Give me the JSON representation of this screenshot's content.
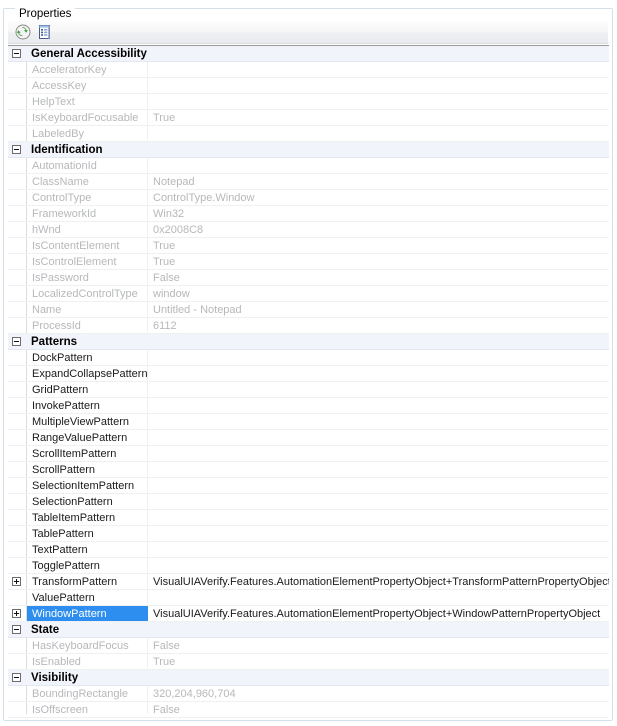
{
  "groupbox": {
    "title": "Properties"
  },
  "toolbar": {
    "buttons": [
      {
        "name": "refresh-icon",
        "tooltip": "Refresh"
      },
      {
        "name": "properties-list-icon",
        "tooltip": "Properties"
      }
    ]
  },
  "colors": {
    "selection": "#2e8ef0",
    "category_bg": "#f1f4fa",
    "dim_text": "#b6b8bb",
    "dark_text": "#1a1a1a"
  },
  "grid": {
    "rows": [
      {
        "type": "category",
        "name": "General Accessibility",
        "expander": "minus"
      },
      {
        "type": "property",
        "name": "AcceleratorKey",
        "value": "",
        "tone": "dim"
      },
      {
        "type": "property",
        "name": "AccessKey",
        "value": "",
        "tone": "dim"
      },
      {
        "type": "property",
        "name": "HelpText",
        "value": "",
        "tone": "dim"
      },
      {
        "type": "property",
        "name": "IsKeyboardFocusable",
        "value": "True",
        "tone": "dim"
      },
      {
        "type": "property",
        "name": "LabeledBy",
        "value": "",
        "tone": "dim"
      },
      {
        "type": "category",
        "name": "Identification",
        "expander": "minus"
      },
      {
        "type": "property",
        "name": "AutomationId",
        "value": "",
        "tone": "dim"
      },
      {
        "type": "property",
        "name": "ClassName",
        "value": "Notepad",
        "tone": "dim"
      },
      {
        "type": "property",
        "name": "ControlType",
        "value": "ControlType.Window",
        "tone": "dim"
      },
      {
        "type": "property",
        "name": "FrameworkId",
        "value": "Win32",
        "tone": "dim"
      },
      {
        "type": "property",
        "name": "hWnd",
        "value": "0x2008C8",
        "tone": "dim"
      },
      {
        "type": "property",
        "name": "IsContentElement",
        "value": "True",
        "tone": "dim"
      },
      {
        "type": "property",
        "name": "IsControlElement",
        "value": "True",
        "tone": "dim"
      },
      {
        "type": "property",
        "name": "IsPassword",
        "value": "False",
        "tone": "dim"
      },
      {
        "type": "property",
        "name": "LocalizedControlType",
        "value": "window",
        "tone": "dim"
      },
      {
        "type": "property",
        "name": "Name",
        "value": "Untitled - Notepad",
        "tone": "dim"
      },
      {
        "type": "property",
        "name": "ProcessId",
        "value": "6112",
        "tone": "dim"
      },
      {
        "type": "category",
        "name": "Patterns",
        "expander": "minus"
      },
      {
        "type": "property",
        "name": "DockPattern",
        "value": "",
        "tone": "dark"
      },
      {
        "type": "property",
        "name": "ExpandCollapsePattern",
        "value": "",
        "tone": "dark"
      },
      {
        "type": "property",
        "name": "GridPattern",
        "value": "",
        "tone": "dark"
      },
      {
        "type": "property",
        "name": "InvokePattern",
        "value": "",
        "tone": "dark"
      },
      {
        "type": "property",
        "name": "MultipleViewPattern",
        "value": "",
        "tone": "dark"
      },
      {
        "type": "property",
        "name": "RangeValuePattern",
        "value": "",
        "tone": "dark"
      },
      {
        "type": "property",
        "name": "ScrollItemPattern",
        "value": "",
        "tone": "dark"
      },
      {
        "type": "property",
        "name": "ScrollPattern",
        "value": "",
        "tone": "dark"
      },
      {
        "type": "property",
        "name": "SelectionItemPattern",
        "value": "",
        "tone": "dark"
      },
      {
        "type": "property",
        "name": "SelectionPattern",
        "value": "",
        "tone": "dark"
      },
      {
        "type": "property",
        "name": "TableItemPattern",
        "value": "",
        "tone": "dark"
      },
      {
        "type": "property",
        "name": "TablePattern",
        "value": "",
        "tone": "dark"
      },
      {
        "type": "property",
        "name": "TextPattern",
        "value": "",
        "tone": "dark"
      },
      {
        "type": "property",
        "name": "TogglePattern",
        "value": "",
        "tone": "dark"
      },
      {
        "type": "property",
        "name": "TransformPattern",
        "value": "VisualUIAVerify.Features.AutomationElementPropertyObject+TransformPatternPropertyObject",
        "tone": "dark",
        "expander": "plus"
      },
      {
        "type": "property",
        "name": "ValuePattern",
        "value": "",
        "tone": "dark"
      },
      {
        "type": "property",
        "name": "WindowPattern",
        "value": "VisualUIAVerify.Features.AutomationElementPropertyObject+WindowPatternPropertyObject",
        "tone": "dark",
        "expander": "plus",
        "selected": true
      },
      {
        "type": "category",
        "name": "State",
        "expander": "minus"
      },
      {
        "type": "property",
        "name": "HasKeyboardFocus",
        "value": "False",
        "tone": "dim"
      },
      {
        "type": "property",
        "name": "IsEnabled",
        "value": "True",
        "tone": "dim"
      },
      {
        "type": "category",
        "name": "Visibility",
        "expander": "minus"
      },
      {
        "type": "property",
        "name": "BoundingRectangle",
        "value": "320,204,960,704",
        "tone": "dim"
      },
      {
        "type": "property",
        "name": "IsOffscreen",
        "value": "False",
        "tone": "dim"
      }
    ]
  }
}
